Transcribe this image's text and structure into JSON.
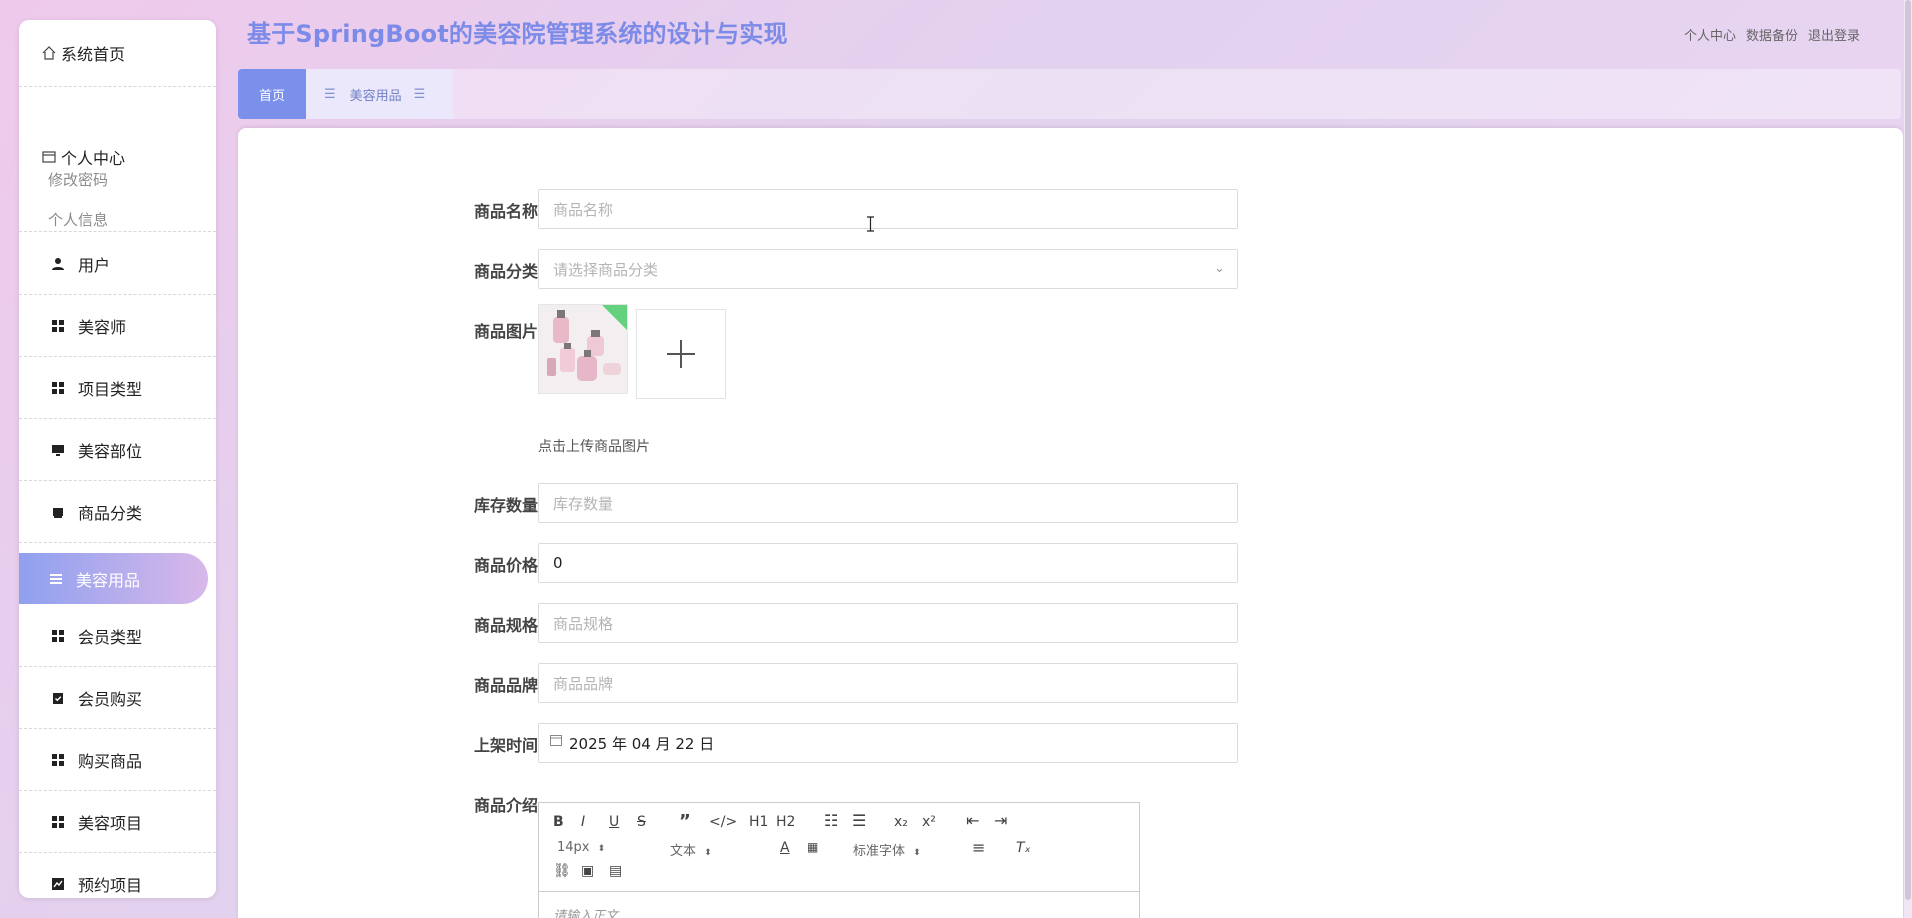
{
  "app": {
    "title": "基于SpringBoot的美容院管理系统的设计与实现"
  },
  "header": {
    "links": [
      "个人中心",
      "数据备份",
      "退出登录"
    ]
  },
  "sidebar": {
    "home": "系统首页",
    "personal_center": {
      "label": "个人中心",
      "items": [
        "修改密码",
        "个人信息"
      ]
    },
    "items": [
      {
        "label": "用户",
        "icon": "user-icon"
      },
      {
        "label": "美容师",
        "icon": "grid-icon"
      },
      {
        "label": "项目类型",
        "icon": "grid-icon"
      },
      {
        "label": "美容部位",
        "icon": "monitor-icon"
      },
      {
        "label": "商品分类",
        "icon": "box-icon"
      },
      {
        "label": "美容用品",
        "icon": "list-icon",
        "active": true
      },
      {
        "label": "会员类型",
        "icon": "grid-icon"
      },
      {
        "label": "会员购买",
        "icon": "clipboard-check-icon"
      },
      {
        "label": "购买商品",
        "icon": "grid-icon"
      },
      {
        "label": "美容项目",
        "icon": "grid-icon"
      },
      {
        "label": "预约项目",
        "icon": "chart-icon"
      }
    ]
  },
  "tabs": {
    "home": "首页",
    "current": "美容用品"
  },
  "form": {
    "name": {
      "label": "商品名称",
      "placeholder": "商品名称"
    },
    "category": {
      "label": "商品分类",
      "placeholder": "请选择商品分类"
    },
    "image": {
      "label": "商品图片",
      "hint": "点击上传商品图片"
    },
    "stock": {
      "label": "库存数量",
      "placeholder": "库存数量"
    },
    "price": {
      "label": "商品价格",
      "value": "0"
    },
    "spec": {
      "label": "商品规格",
      "placeholder": "商品规格"
    },
    "brand": {
      "label": "商品品牌",
      "placeholder": "商品品牌"
    },
    "shelf_time": {
      "label": "上架时间",
      "value": "2025 年 04 月 22 日"
    },
    "description": {
      "label": "商品介绍",
      "placeholder": "请输入正文",
      "toolbar": {
        "font_size": "14px",
        "format": "文本",
        "font_family": "标准字体",
        "subscript": "x₂",
        "superscript": "x²",
        "h1": "H1",
        "h2": "H2"
      }
    }
  }
}
